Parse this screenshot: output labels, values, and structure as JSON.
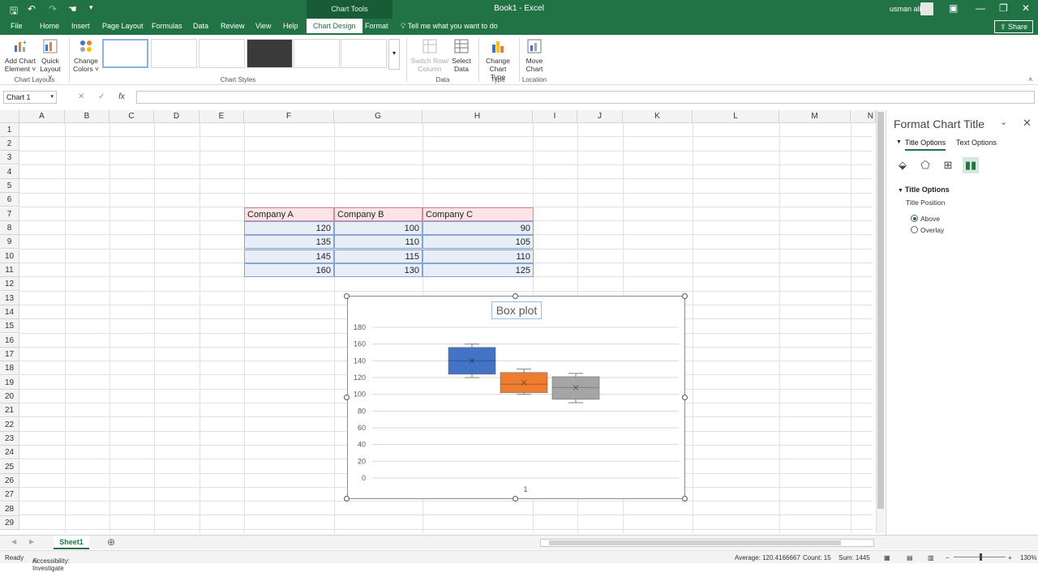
{
  "titlebar": {
    "chart_tools": "Chart Tools",
    "doc_title": "Book1  -  Excel",
    "user": "usman ali"
  },
  "tabs": [
    "File",
    "Home",
    "Insert",
    "Page Layout",
    "Formulas",
    "Data",
    "Review",
    "View",
    "Help",
    "Chart Design",
    "Format"
  ],
  "active_tab": "Chart Design",
  "tell_me": "Tell me what you want to do",
  "share": "Share",
  "ribbon": {
    "add_chart_element": [
      "Add Chart",
      "Element ˅"
    ],
    "quick_layout": [
      "Quick",
      "Layout ˅"
    ],
    "group_chart_layouts": "Chart Layouts",
    "change_colors": [
      "Change",
      "Colors ˅"
    ],
    "group_chart_styles": "Chart Styles",
    "switch_row_column": [
      "Switch Row/",
      "Column"
    ],
    "select_data": [
      "Select",
      "Data"
    ],
    "group_data": "Data",
    "change_chart_type": [
      "Change",
      "Chart Type"
    ],
    "group_type": "Type",
    "move_chart": [
      "Move",
      "Chart"
    ],
    "group_location": "Location"
  },
  "formula_bar": {
    "name_box": "Chart 1",
    "cancel": "✕",
    "enter": "✓",
    "fx": "fx",
    "value": ""
  },
  "columns": [
    "A",
    "B",
    "C",
    "D",
    "E",
    "F",
    "G",
    "H",
    "I",
    "J",
    "K",
    "L",
    "M",
    "N"
  ],
  "rows": [
    "1",
    "2",
    "3",
    "4",
    "5",
    "6",
    "7",
    "8",
    "9",
    "10",
    "11",
    "12",
    "13",
    "14",
    "15",
    "16",
    "17",
    "18",
    "19",
    "20",
    "21",
    "22",
    "23",
    "24",
    "25",
    "26",
    "27",
    "28",
    "29"
  ],
  "table": {
    "headers": [
      "Company A",
      "Company B",
      "Company C"
    ],
    "rows": [
      [
        "120",
        "100",
        "90"
      ],
      [
        "135",
        "110",
        "105"
      ],
      [
        "145",
        "115",
        "110"
      ],
      [
        "160",
        "130",
        "125"
      ]
    ]
  },
  "chart_data": {
    "type": "box",
    "title": "Box plot",
    "categories": [
      "1"
    ],
    "ylim": [
      0,
      180
    ],
    "yticks": [
      0,
      20,
      40,
      60,
      80,
      100,
      120,
      140,
      160,
      180
    ],
    "grid": true,
    "series": [
      {
        "color": "#4472c4",
        "min": 120,
        "q1": 124,
        "median": 140,
        "mean": 140,
        "q3": 156,
        "max": 160
      },
      {
        "color": "#ed7d31",
        "min": 100,
        "q1": 102,
        "median": 112,
        "mean": 114,
        "q3": 126,
        "max": 130
      },
      {
        "color": "#a5a5a5",
        "min": 90,
        "q1": 94,
        "median": 108,
        "mean": 108,
        "q3": 121,
        "max": 125
      }
    ]
  },
  "format_pane": {
    "title": "Format Chart Title",
    "tab_title_options": "Title Options",
    "tab_text_options": "Text Options",
    "section": "Title Options",
    "title_position_label": "Title Position",
    "options": [
      "Above",
      "Overlay"
    ],
    "selected": "Above"
  },
  "sheet": {
    "tab": "Sheet1"
  },
  "status": {
    "ready": "Ready",
    "accessibility": "Accessibility: Investigate",
    "average": "Average: 120.4166667",
    "count": "Count: 15",
    "sum": "Sum: 1445",
    "zoom": "130%"
  }
}
